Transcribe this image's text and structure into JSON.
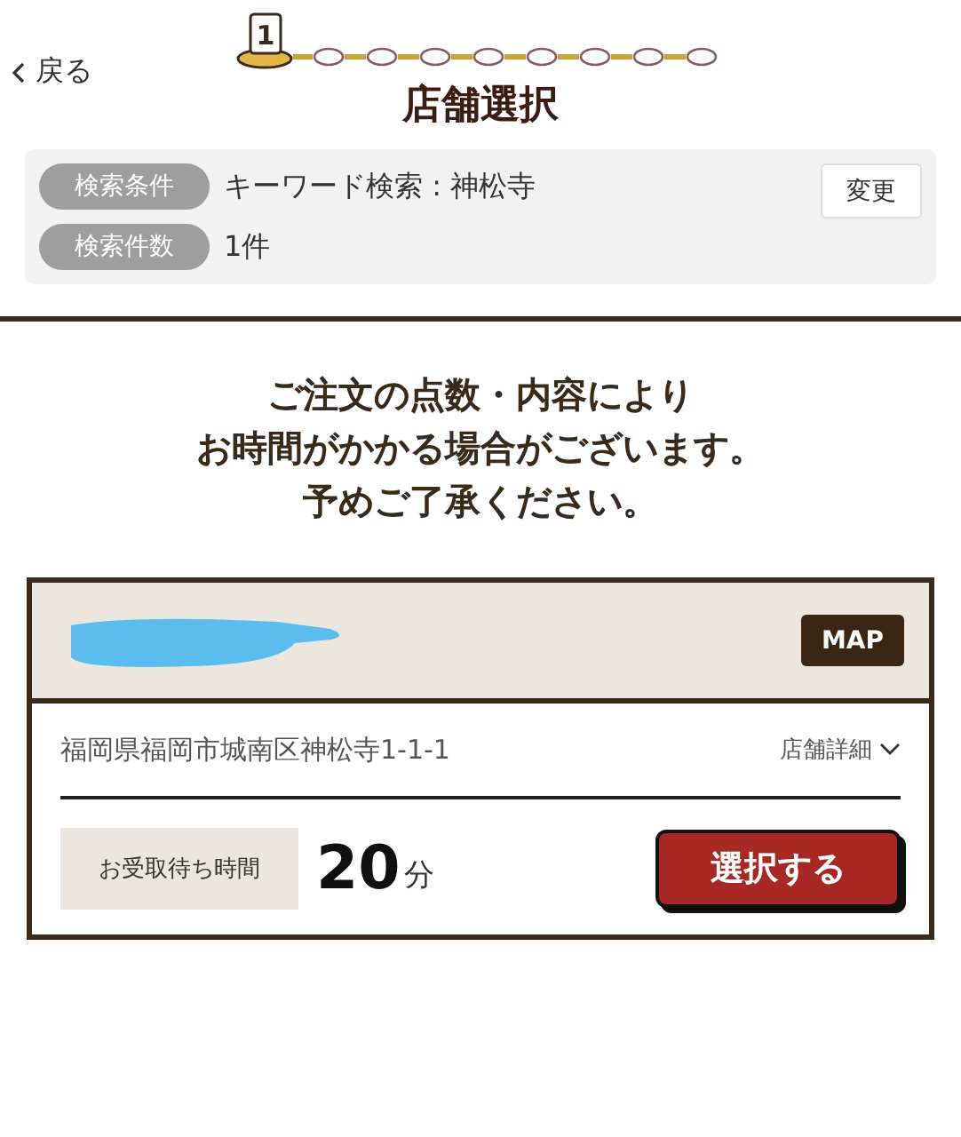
{
  "back_link": {
    "label": "戻る"
  },
  "progress": {
    "current_label": "1",
    "steps": [
      {
        "selected": true
      },
      {
        "selected": false
      },
      {
        "selected": false
      },
      {
        "selected": false
      },
      {
        "selected": false
      },
      {
        "selected": false
      },
      {
        "selected": false
      },
      {
        "selected": false
      },
      {
        "selected": false
      }
    ]
  },
  "title": "店舗選択",
  "search_summary": {
    "rows": [
      {
        "label": "検索条件",
        "value": "キーワード検索 : 神松寺"
      },
      {
        "label": "検索件数",
        "value": "1件"
      }
    ],
    "change_button": "変更"
  },
  "notice": [
    "ご注文の点数・内容により",
    "お時間がかかる場合がございます。",
    "予めご了承ください。"
  ],
  "store_card": {
    "name_redacted": true,
    "map_button": "MAP",
    "address": "福岡県福岡市城南区神松寺1-1-1",
    "details_link": "店舗詳細",
    "wait_label": "お受取待ち時間",
    "wait_value": "20",
    "wait_unit": "分",
    "select_button": "選択する"
  }
}
